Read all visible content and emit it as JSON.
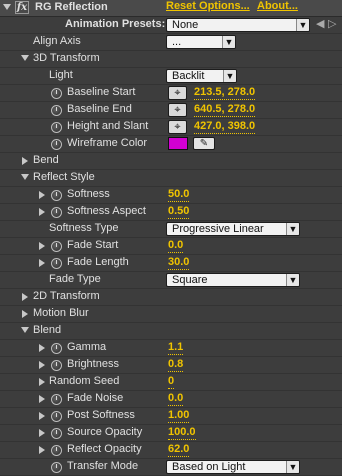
{
  "effect": {
    "name": "RG Reflection",
    "reset_label": "Reset Options...",
    "about_label": "About...",
    "fx_label": "fx"
  },
  "presets": {
    "label": "Animation Presets:",
    "value": "None",
    "prev_icon": "◀",
    "next_icon": "▷"
  },
  "align_axis": {
    "label": "Align Axis",
    "value": "..."
  },
  "transform3d": {
    "label": "3D Transform",
    "light_label": "Light",
    "light_value": "Backlit",
    "baseline_start_label": "Baseline Start",
    "baseline_start_value": "213.5, 278.0",
    "baseline_end_label": "Baseline End",
    "baseline_end_value": "640.5, 278.0",
    "height_slant_label": "Height and Slant",
    "height_slant_value": "427.0, 398.0",
    "wireframe_label": "Wireframe Color",
    "wireframe_color": "#d200d2",
    "crosshair_icon": "⌖",
    "eyedropper_icon": "✎"
  },
  "bend": {
    "label": "Bend"
  },
  "reflect_style": {
    "label": "Reflect Style",
    "softness_label": "Softness",
    "softness_value": "50.0",
    "softness_aspect_label": "Softness Aspect",
    "softness_aspect_value": "0.50",
    "softness_type_label": "Softness Type",
    "softness_type_value": "Progressive Linear",
    "fade_start_label": "Fade Start",
    "fade_start_value": "0.0",
    "fade_length_label": "Fade Length",
    "fade_length_value": "30.0",
    "fade_type_label": "Fade Type",
    "fade_type_value": "Square"
  },
  "transform2d": {
    "label": "2D Transform"
  },
  "motion_blur": {
    "label": "Motion Blur"
  },
  "blend": {
    "label": "Blend",
    "gamma_label": "Gamma",
    "gamma_value": "1.1",
    "brightness_label": "Brightness",
    "brightness_value": "0.8",
    "random_seed_label": "Random Seed",
    "random_seed_value": "0",
    "fade_noise_label": "Fade Noise",
    "fade_noise_value": "0.0",
    "post_softness_label": "Post Softness",
    "post_softness_value": "1.00",
    "source_opacity_label": "Source Opacity",
    "source_opacity_value": "100.0",
    "reflect_opacity_label": "Reflect Opacity",
    "reflect_opacity_value": "62.0",
    "transfer_mode_label": "Transfer Mode",
    "transfer_mode_value": "Based on Light"
  },
  "colors": {
    "panel_bg": "#3c3c3c",
    "value_accent": "#f0c400",
    "text": "#e0e0e0"
  }
}
